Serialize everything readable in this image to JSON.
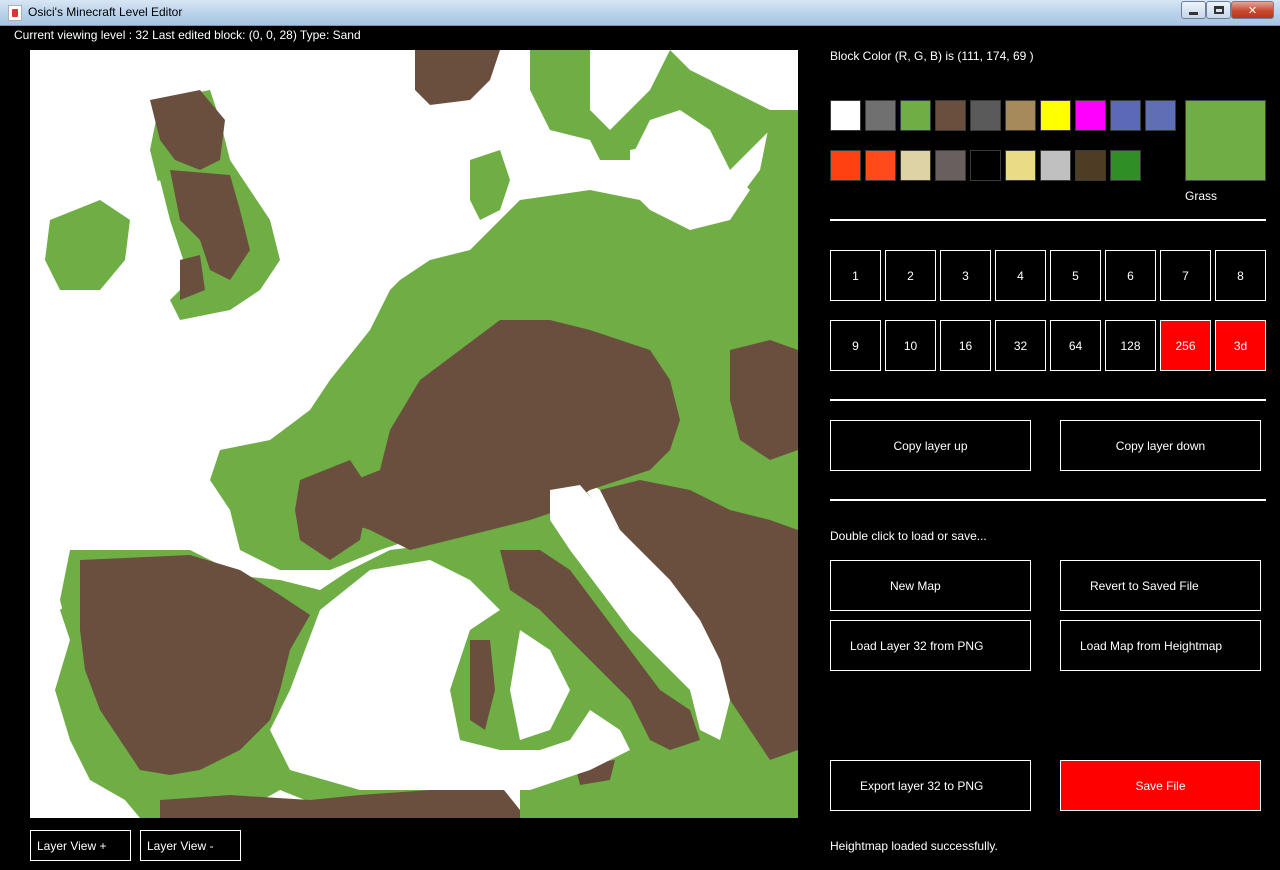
{
  "window": {
    "title": "Osici's Minecraft Level Editor",
    "icon": "java-cup-icon"
  },
  "status_line": "Current viewing level : 32 Last edited block: (0, 0, 28) Type: Sand",
  "colors": {
    "water": "#ffffff",
    "grass": "#6fae45",
    "dirt": "#6b4f3e",
    "accent_red": "#ff0000"
  },
  "block_color": {
    "text": "Block Color (R, G, B) is (111, 174, 69 )"
  },
  "palette": {
    "row1": [
      "#ffffff",
      "#707070",
      "#6fae45",
      "#6b4f3e",
      "#5a5a5a",
      "#a68a5c",
      "#ffff00",
      "#ff00ff",
      "#5a6ab8",
      "#5f6fb5"
    ],
    "row2": [
      "#ff4010",
      "#ff4a1a",
      "#ddd3a5",
      "#6a5f5f",
      "#000000",
      "#e8dc87",
      "#c0c0c0",
      "#4e3c25",
      "#2f8f26"
    ],
    "selected_color": "#6fae45",
    "selected_name": "Grass"
  },
  "brush_sizes": {
    "row1": [
      "1",
      "2",
      "3",
      "4",
      "5",
      "6",
      "7",
      "8"
    ],
    "row2": [
      "9",
      "10",
      "16",
      "32",
      "64",
      "128",
      "256",
      "3d"
    ]
  },
  "layer_buttons": {
    "copy_up": "Copy layer up",
    "copy_down": "Copy layer down"
  },
  "file_section": {
    "hint": "Double click to load or save...",
    "new_map": "New Map",
    "revert": "Revert to Saved File",
    "load_png": "Load Layer 32 from PNG",
    "load_heightmap": "Load Map from Heightmap",
    "export_png": "Export layer 32 to PNG",
    "save": "Save File"
  },
  "bottom": {
    "layer_view_plus": "Layer View +",
    "layer_view_minus": "Layer View -",
    "message": "Heightmap loaded successfully."
  }
}
